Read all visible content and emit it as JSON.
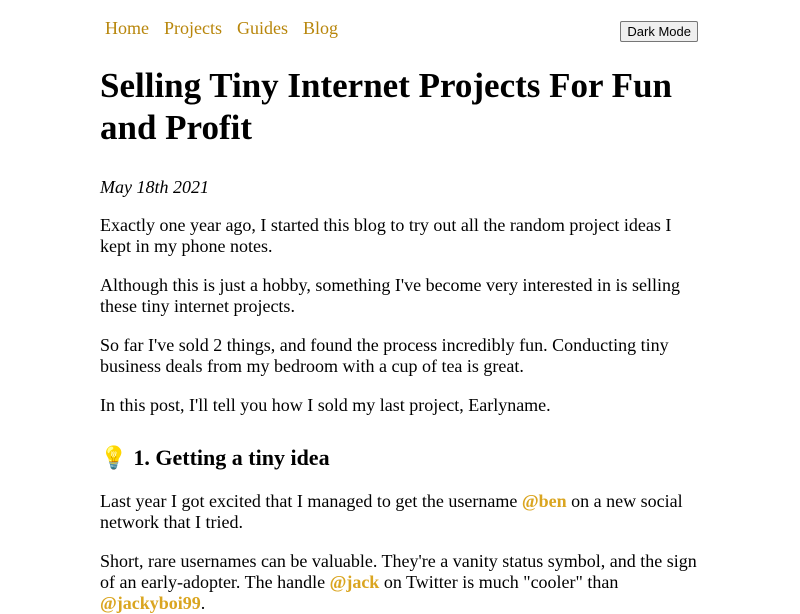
{
  "nav": {
    "items": [
      "Home",
      "Projects",
      "Guides",
      "Blog"
    ]
  },
  "toolbar": {
    "dark_mode_label": "Dark Mode"
  },
  "article": {
    "title": "Selling Tiny Internet Projects For Fun and Profit",
    "date": "May 18th 2021",
    "paragraphs": [
      "Exactly one year ago, I started this blog to try out all the random project ideas I kept in my phone notes.",
      "Although this is just a hobby, something I've become very interested in is selling these tiny internet projects.",
      "So far I've sold 2 things, and found the process incredibly fun. Conducting tiny business deals from my bedroom with a cup of tea is great.",
      "In this post, I'll tell you how I sold my last project, Earlyname."
    ],
    "section1": {
      "emoji": "💡",
      "emoji_name": "lightbulb-icon",
      "heading": "1. Getting a tiny idea",
      "p1": {
        "before": "Last year I got excited that I managed to get the username ",
        "handle": "@ben",
        "after": " on a new social network that I tried."
      },
      "p2": {
        "before": "Short, rare usernames can be valuable. They're a vanity status symbol, and the sign of an early-adopter. The handle ",
        "handle1": "@jack",
        "middle": " on Twitter is much \"cooler\" than ",
        "handle2": "@jackyboi99",
        "after": "."
      }
    }
  },
  "colors": {
    "link": "#b8860b",
    "handle": "#daa520"
  }
}
